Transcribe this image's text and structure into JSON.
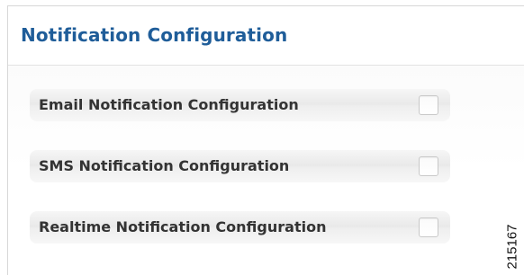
{
  "panel": {
    "title": "Notification Configuration",
    "options": [
      {
        "label": "Email Notification Configuration",
        "checked": false
      },
      {
        "label": "SMS Notification Configuration",
        "checked": false
      },
      {
        "label": "Realtime Notification Configuration",
        "checked": false
      }
    ]
  },
  "figure_id": "215167",
  "colors": {
    "title": "#1f5d99",
    "label": "#333333",
    "row_background": "#efefef",
    "border": "#d7d7d7"
  }
}
